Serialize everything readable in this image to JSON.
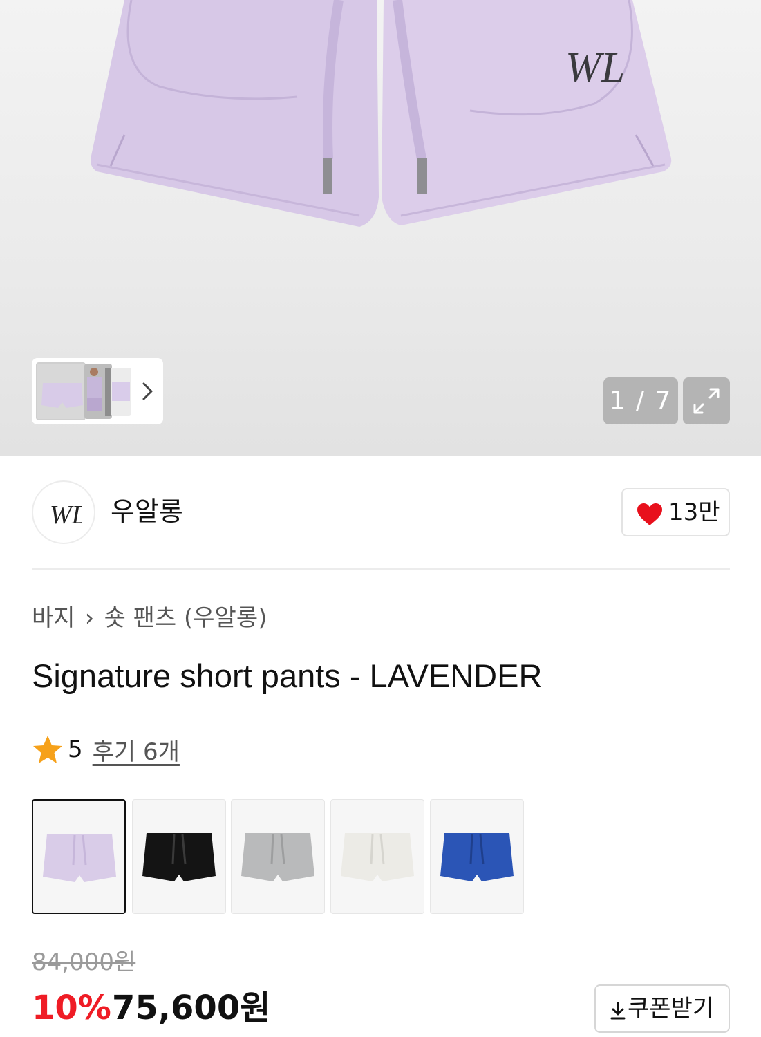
{
  "gallery": {
    "counter": "1 / 7",
    "current_index": 1,
    "total": 7
  },
  "brand": {
    "name": "우알롱",
    "likes": "13만"
  },
  "breadcrumb": {
    "parent": "바지",
    "current": "숏 팬츠 (우알롱)"
  },
  "product": {
    "title": "Signature short pants - LAVENDER"
  },
  "rating": {
    "score": "5",
    "reviews_label": "후기 6개"
  },
  "colors": {
    "options": [
      {
        "name": "lavender",
        "hex": "#d9cce8",
        "selected": true
      },
      {
        "name": "black",
        "hex": "#141414",
        "selected": false
      },
      {
        "name": "gray",
        "hex": "#b9babb",
        "selected": false
      },
      {
        "name": "ivory",
        "hex": "#ecebe6",
        "selected": false
      },
      {
        "name": "blue",
        "hex": "#2b55b6",
        "selected": false
      }
    ]
  },
  "price": {
    "original": "84,000원",
    "discount": "10%",
    "sale": "75,600원",
    "coupon_label": "쿠폰받기"
  },
  "theme": {
    "accent": "#ef1c25",
    "heart": "#e8101c",
    "star": "#f6a11a"
  }
}
